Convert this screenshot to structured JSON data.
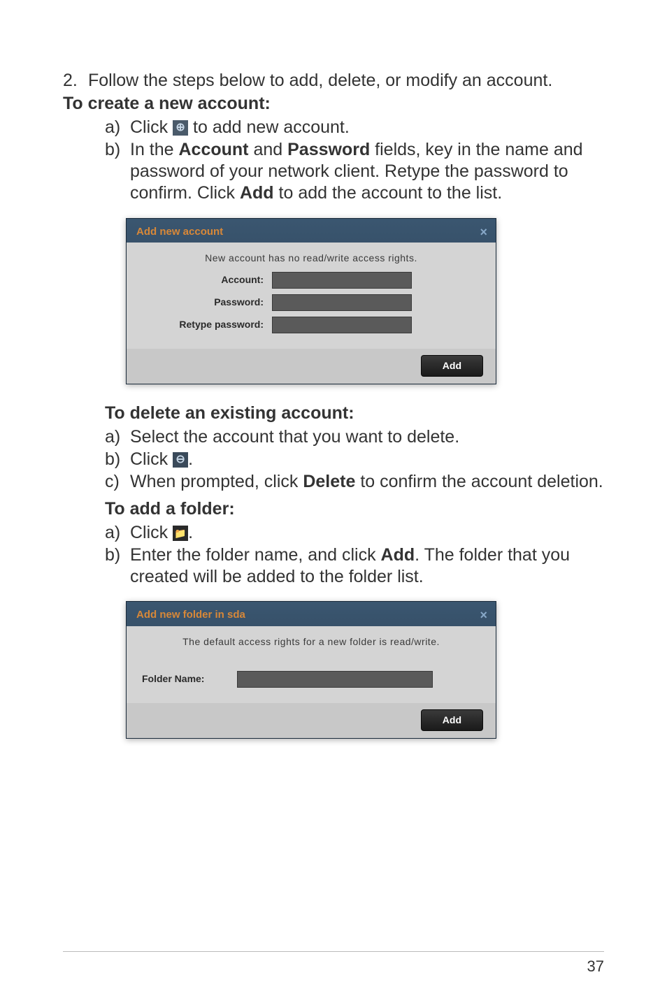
{
  "step2": {
    "num": "2.",
    "text": "Follow the steps below to add, delete, or modify an account."
  },
  "createHeading": "To create a new account:",
  "createA": {
    "letter": "a)",
    "pre": "Click ",
    "post": " to add new account."
  },
  "createB": {
    "letter": "b)",
    "pre": "In the ",
    "bold1": "Account",
    "mid1": " and ",
    "bold2": "Password",
    "mid2": " fields, key in the name and password of your network client. Retype the password to confirm. Click ",
    "bold3": "Add",
    "post": " to add the account to the list."
  },
  "dialog1": {
    "title": "Add new account",
    "msg": "New account has no read/write access rights.",
    "accountLabel": "Account:",
    "passwordLabel": "Password:",
    "retypeLabel": "Retype password:",
    "addBtn": "Add"
  },
  "deleteHeading": "To delete an existing account:",
  "deleteA": {
    "letter": "a)",
    "text": "Select the account that you want to delete."
  },
  "deleteB": {
    "letter": "b)",
    "pre": "Click ",
    "post": "."
  },
  "deleteC": {
    "letter": "c)",
    "pre": "When prompted, click ",
    "bold": "Delete",
    "post": " to confirm the account deletion."
  },
  "folderHeading": "To add a folder:",
  "folderA": {
    "letter": "a)",
    "pre": "Click ",
    "post": "."
  },
  "folderB": {
    "letter": "b)",
    "pre": "Enter the folder name, and click ",
    "bold": "Add",
    "post": ". The folder that you created will be added to the folder list."
  },
  "dialog2": {
    "title": "Add new folder in   sda",
    "msg": "The default access rights for a new folder is read/write.",
    "folderLabel": "Folder Name:",
    "addBtn": "Add"
  },
  "pageNum": "37"
}
